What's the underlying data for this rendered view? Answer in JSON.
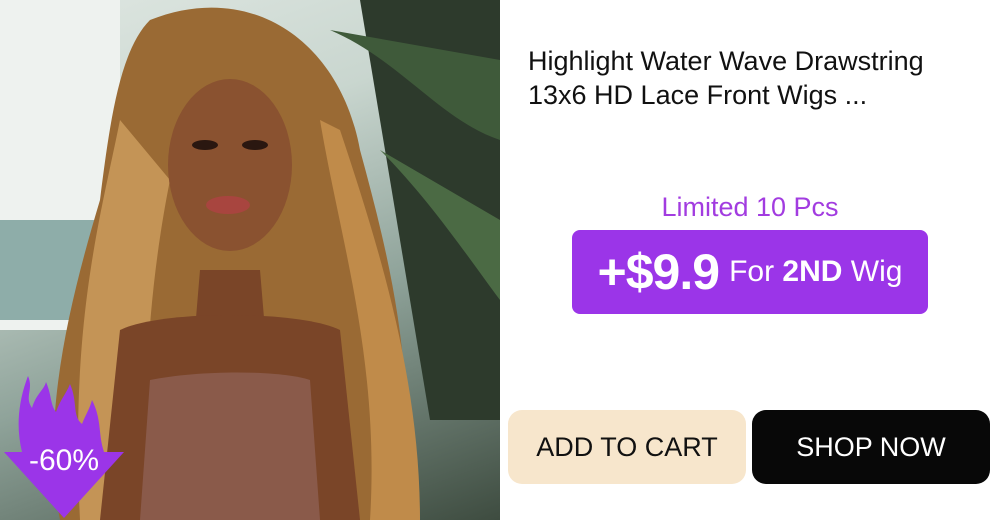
{
  "product": {
    "title_line1": "Highlight Water Wave Drawstring",
    "title_line2": "13x6 HD Lace Front Wigs ..."
  },
  "promo": {
    "limited_text": "Limited 10 Pcs",
    "price": "+$9.9",
    "for_text": "For",
    "wig_text": "2ND",
    "wig_suffix": "Wig"
  },
  "discount_badge": "-60%",
  "buttons": {
    "add_to_cart": "ADD TO CART",
    "shop_now": "SHOP NOW"
  },
  "colors": {
    "accent_purple": "#9b35e8",
    "limited_text": "#a23ce0",
    "add_to_cart_bg": "#f7e6cc",
    "shop_now_bg": "#080808"
  },
  "icons": [
    "flame-arrow-icon"
  ]
}
